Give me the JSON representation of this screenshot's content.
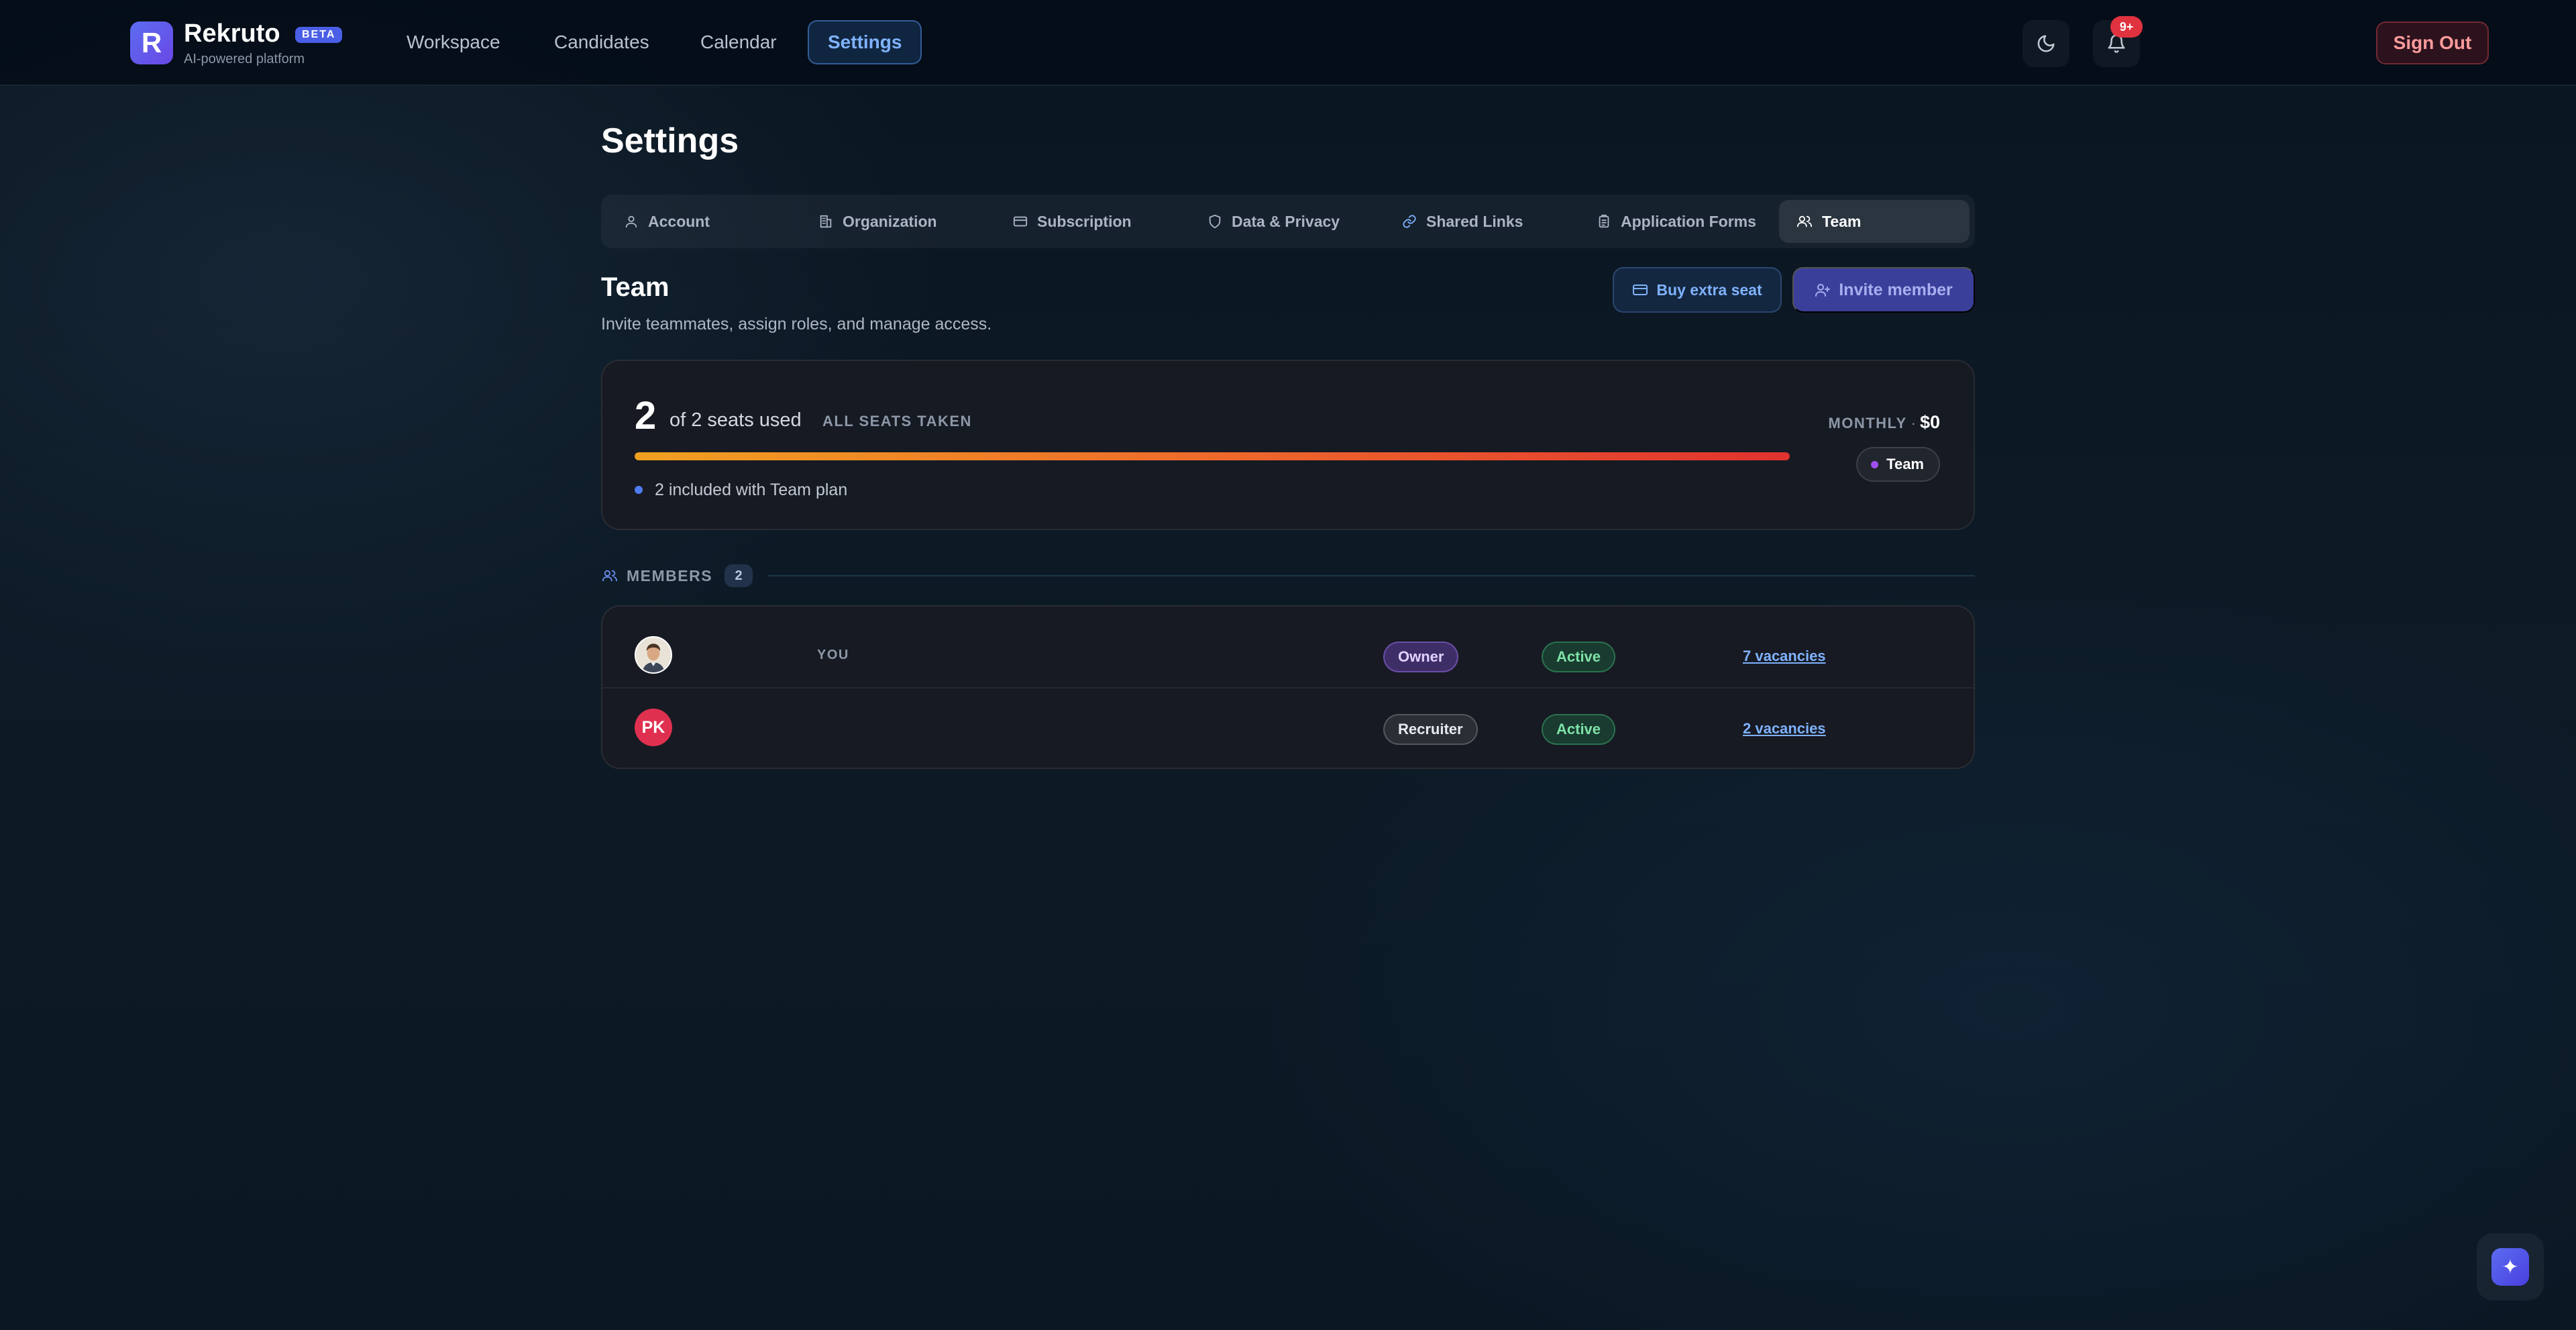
{
  "brand": {
    "logo_letter": "R",
    "name": "Rekruto",
    "badge": "BETA",
    "tagline": "AI-powered platform"
  },
  "nav": {
    "items": [
      {
        "label": "Workspace"
      },
      {
        "label": "Candidates"
      },
      {
        "label": "Calendar"
      },
      {
        "label": "Settings",
        "active": true
      }
    ],
    "notification_badge": "9+",
    "sign_out": "Sign Out"
  },
  "page": {
    "title": "Settings"
  },
  "tabs": [
    {
      "label": "Account",
      "icon": "user-icon"
    },
    {
      "label": "Organization",
      "icon": "building-icon"
    },
    {
      "label": "Subscription",
      "icon": "credit-card-icon"
    },
    {
      "label": "Data & Privacy",
      "icon": "shield-icon"
    },
    {
      "label": "Shared Links",
      "icon": "link-icon"
    },
    {
      "label": "Application Forms",
      "icon": "clipboard-icon"
    },
    {
      "label": "Team",
      "icon": "users-icon",
      "active": true
    }
  ],
  "team": {
    "title": "Team",
    "subtitle": "Invite teammates, assign roles, and manage access.",
    "buy_seat_label": "Buy extra seat",
    "invite_label": "Invite member"
  },
  "seats": {
    "used": "2",
    "of_text": "of 2 seats used",
    "status": "ALL SEATS TAKEN",
    "usage_fraction": 1.0,
    "included_text": "2 included with Team plan",
    "billing_label": "MONTHLY",
    "billing_sep": "·",
    "billing_amount": "$0",
    "plan": "Team"
  },
  "members": {
    "label": "MEMBERS",
    "count": "2",
    "rows": [
      {
        "avatar": "photo",
        "you_tag": "YOU",
        "role": "Owner",
        "status": "Active",
        "vacancies": "7 vacancies"
      },
      {
        "avatar_initials": "PK",
        "role": "Recruiter",
        "status": "Active",
        "vacancies": "2 vacancies"
      }
    ]
  },
  "fab": {
    "glyph": "✦"
  },
  "colors": {
    "accent": "#5b6cf0",
    "active_nav": "#7fb2ff",
    "progress_start": "#f0a020",
    "progress_end": "#e0322f",
    "status_active": "#7ee2a8",
    "danger": "#e0323f"
  }
}
